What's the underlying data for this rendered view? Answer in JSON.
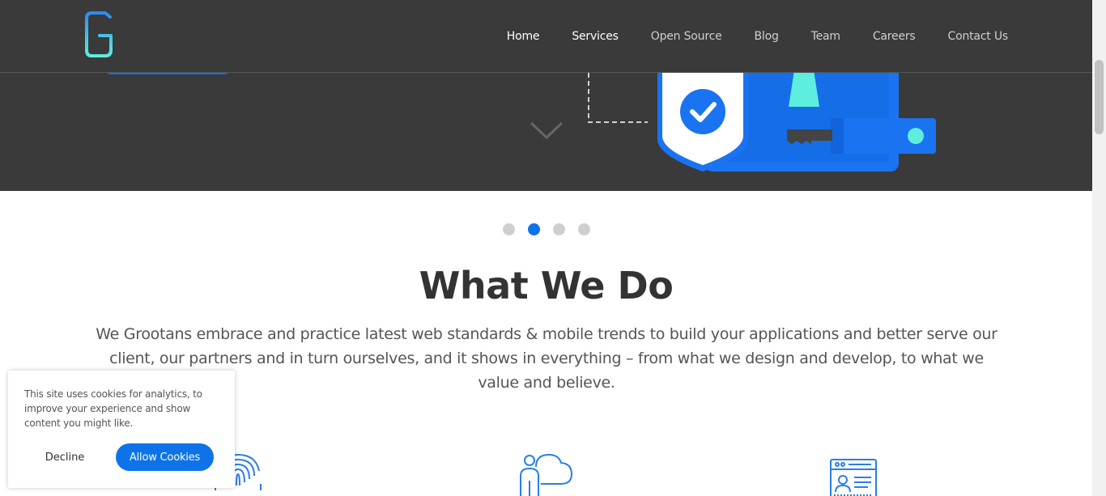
{
  "header": {
    "logo_letter": "G",
    "nav": [
      {
        "label": "Home",
        "active": false
      },
      {
        "label": "Services",
        "active": true
      },
      {
        "label": "Open Source",
        "active": false
      },
      {
        "label": "Blog",
        "active": false
      },
      {
        "label": "Team",
        "active": false
      },
      {
        "label": "Careers",
        "active": false
      },
      {
        "label": "Contact Us",
        "active": false
      }
    ]
  },
  "hero": {
    "illustration": "security-shield-key-icon",
    "scroll_icon": "chevron-down-icon"
  },
  "carousel": {
    "slide_count": 4,
    "active_index": 1
  },
  "what_we_do": {
    "title": "What We Do",
    "description": "We Grootans embrace and practice latest web standards & mobile trends to build your applications and better serve our client, our partners and in turn ourselves, and it shows in everything – from what we design and develop, to what we value and believe."
  },
  "services_icons": [
    "fingerprint-icon",
    "person-cloud-icon",
    "profile-window-icon"
  ],
  "cookie_banner": {
    "message": "This site uses cookies for analytics, to improve your experience and show content you might like.",
    "decline_label": "Decline",
    "allow_label": "Allow Cookies"
  },
  "colors": {
    "header_bg": "#3a3a3a",
    "accent": "#0e73e8",
    "title_text": "#333333",
    "body_text": "#555555"
  }
}
